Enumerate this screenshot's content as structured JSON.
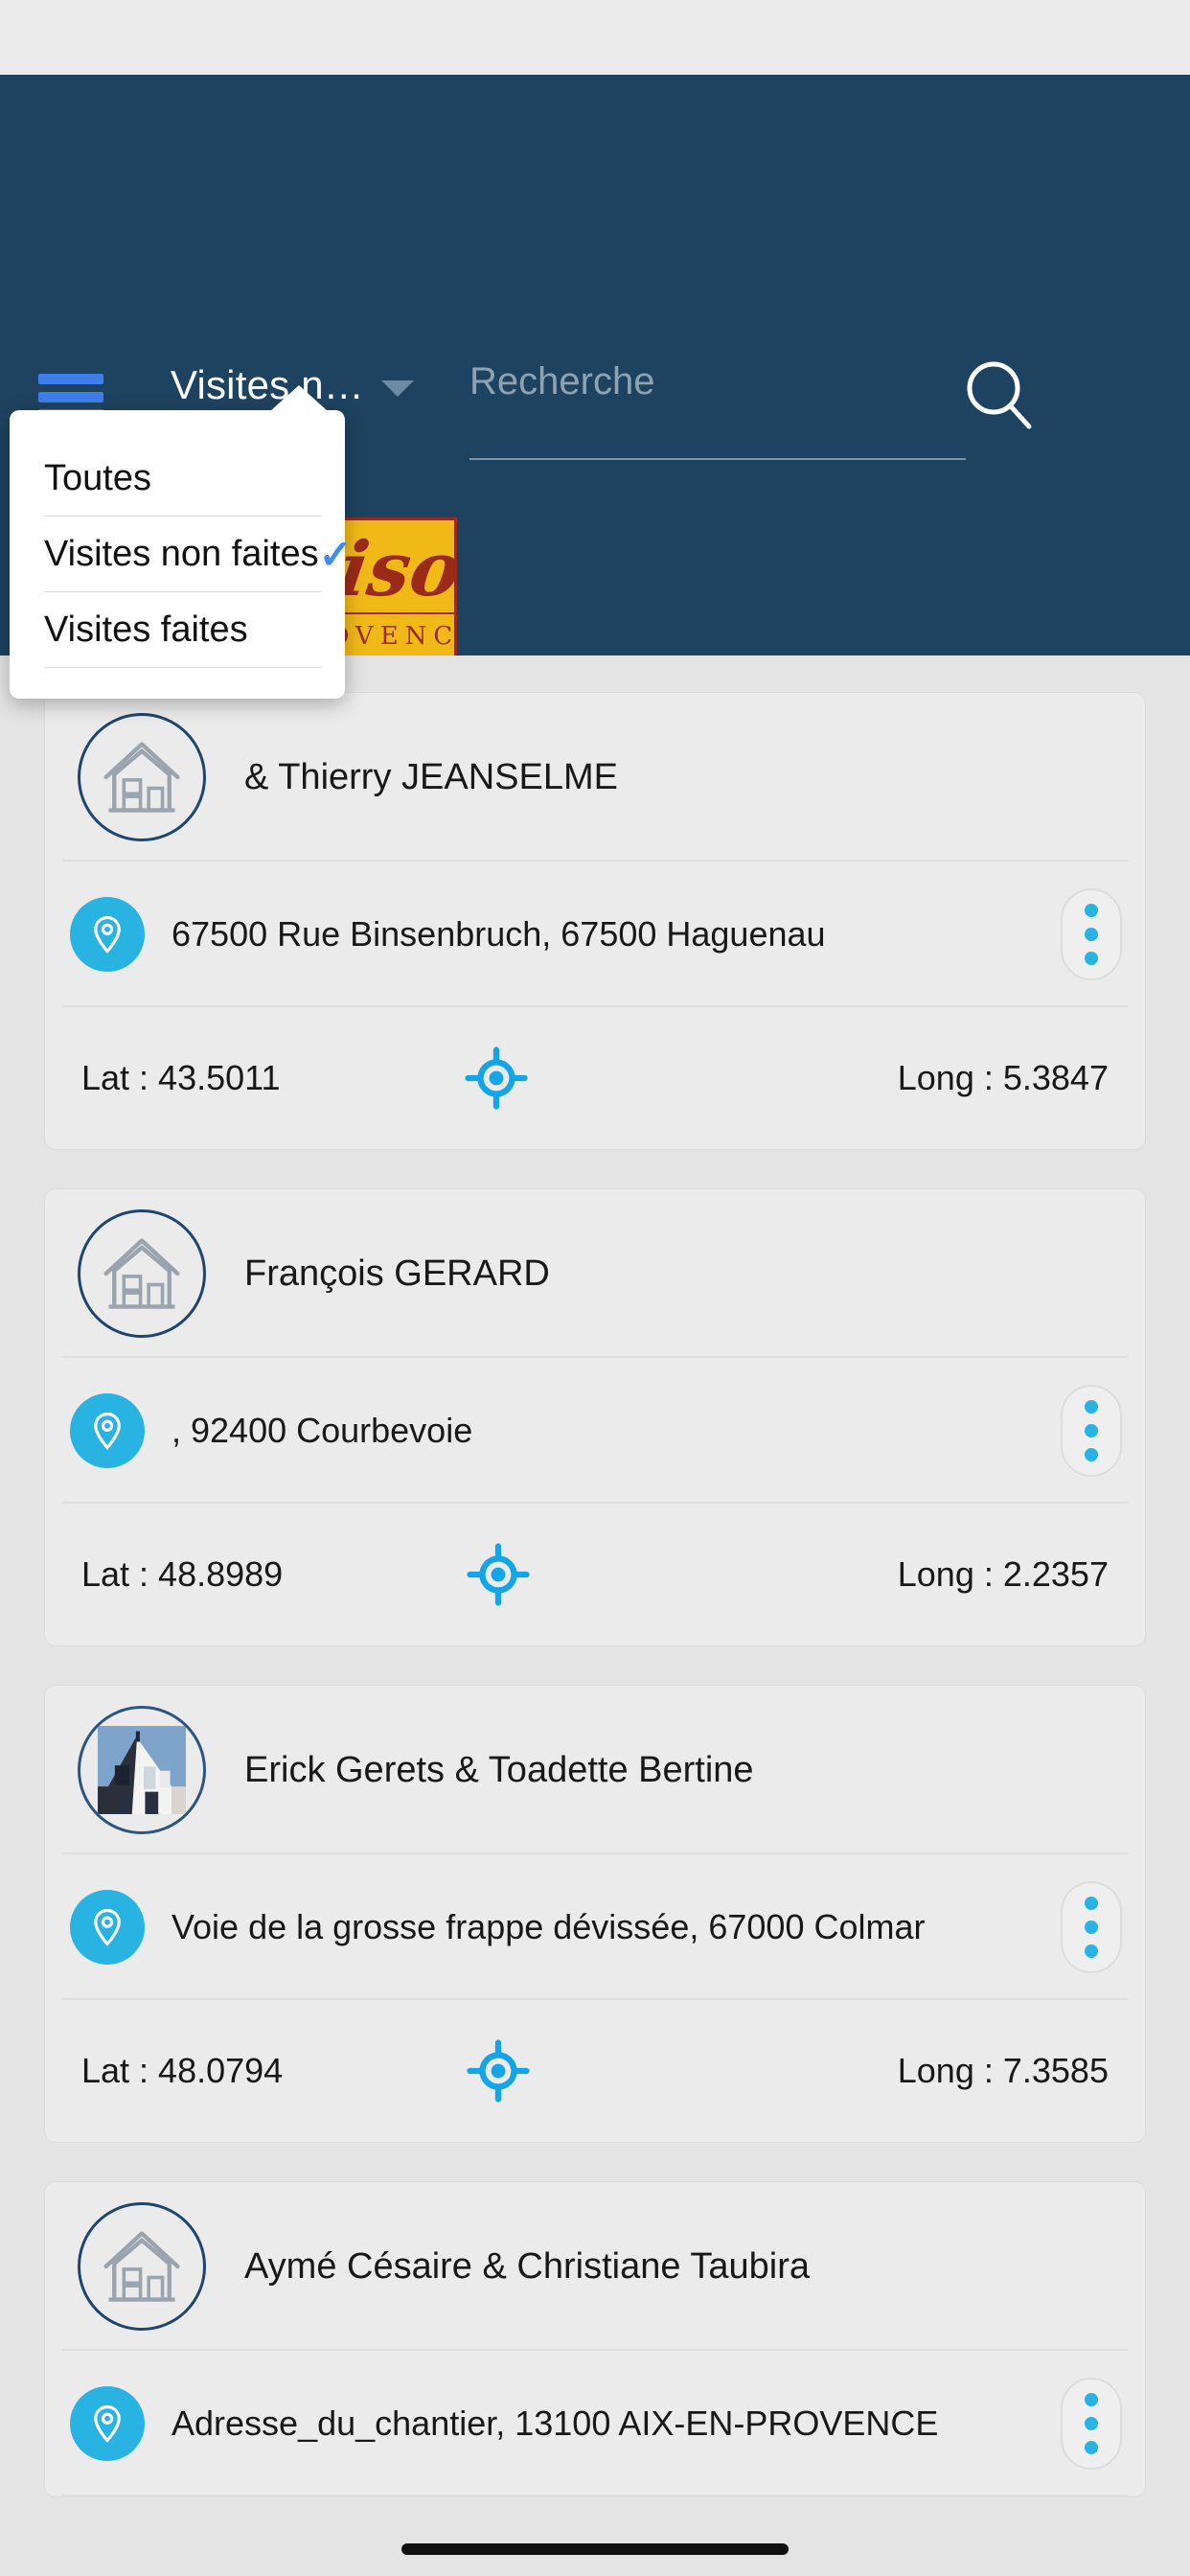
{
  "header": {
    "menu_icon": "hamburger-icon",
    "filter_label": "Visites n…",
    "caret_icon": "caret-down-icon",
    "search_placeholder": "Recherche",
    "search_value": "",
    "search_icon": "search-icon",
    "brand_color": "#1e4360",
    "accent_color": "#3d7eea",
    "logo": {
      "script_text": "Maison",
      "sub_text": "PROVENCE",
      "bg_color": "#f0b918",
      "text_color": "#9a2b19"
    }
  },
  "dropdown": {
    "open": true,
    "check_icon": "check-icon",
    "check_color": "#3d8df5",
    "items": [
      {
        "label": "Toutes",
        "selected": false
      },
      {
        "label": "Visites non faites",
        "selected": true
      },
      {
        "label": "Visites faites",
        "selected": false
      }
    ]
  },
  "list": {
    "pin_icon": "map-pin-icon",
    "gps_icon": "gps-target-icon",
    "kebab_icon": "more-vertical-icon",
    "pin_color": "#28b3e3",
    "cards": [
      {
        "avatar_type": "house-outline-icon",
        "name": "& Thierry JEANSELME",
        "address": "67500 Rue Binsenbruch, 67500 Haguenau",
        "lat": "Lat : 43.5011",
        "long": "Long : 5.3847"
      },
      {
        "avatar_type": "house-outline-icon",
        "name": "François GERARD",
        "address": ", 92400 Courbevoie",
        "lat": "Lat : 48.8989",
        "long": "Long : 2.2357"
      },
      {
        "avatar_type": "house-photo",
        "name": "Erick Gerets & Toadette Bertine",
        "address": "Voie de la grosse frappe dévissée, 67000 Colmar",
        "lat": "Lat : 48.0794",
        "long": "Long : 7.3585"
      },
      {
        "avatar_type": "house-outline-icon",
        "name": "Aymé Césaire & Christiane Taubira",
        "address": "Adresse_du_chantier, 13100 AIX-EN-PROVENCE",
        "lat": "",
        "long": ""
      }
    ]
  }
}
